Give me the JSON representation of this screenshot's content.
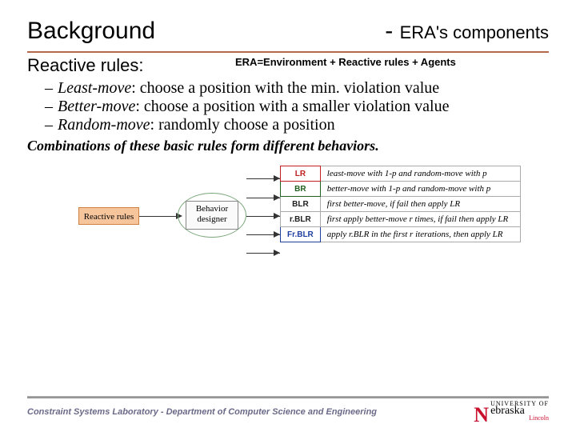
{
  "header": {
    "left": "Background",
    "right_dash": "-",
    "right_sub": "ERA's components"
  },
  "era_formula": "ERA=Environment + Reactive rules + Agents",
  "subtitle": "Reactive rules:",
  "bullets": [
    {
      "dash": "–",
      "term": "Least-move",
      "rest": ": choose a position with the min. violation value"
    },
    {
      "dash": "–",
      "term": "Better-move",
      "rest": ": choose a position with a smaller violation value"
    },
    {
      "dash": "–",
      "term": "Random-move",
      "rest": ": randomly choose a position"
    }
  ],
  "combos": "Combinations of these basic rules form different behaviors.",
  "diagram": {
    "reactive_label": "Reactive rules",
    "behavior_label": "Behavior\ndesigner"
  },
  "behavior_table": [
    {
      "tag": "LR",
      "cls": "tag-lr",
      "desc_html": "least-move with 1-p and random-move with p"
    },
    {
      "tag": "BR",
      "cls": "tag-br",
      "desc_html": "better-move with 1-p and random-move with p"
    },
    {
      "tag": "BLR",
      "cls": "tag-blr",
      "desc_html": "first better-move, if fail then apply LR"
    },
    {
      "tag": "r.BLR",
      "cls": "tag-rblr",
      "desc_html": "first apply better-move r times, if fail then apply LR"
    },
    {
      "tag": "Fr.BLR",
      "cls": "tag-frblr",
      "desc_html": "apply r.BLR in the first r iterations, then apply LR"
    }
  ],
  "footer": {
    "label": "Constraint Systems Laboratory - Department of Computer Science and Engineering",
    "nebraska": {
      "n": "N",
      "univ": "UNIVERSITY OF",
      "word": "ebraska",
      "lincoln": "Lincoln"
    }
  }
}
